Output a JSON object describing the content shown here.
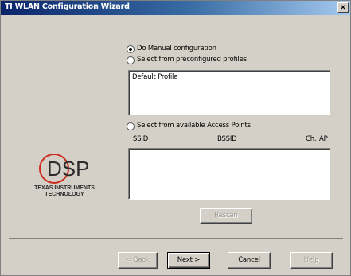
{
  "window": {
    "title": "TI WLAN Configuration Wizard",
    "close_symbol": "×"
  },
  "options": {
    "manual_label": "Do Manual configuration",
    "preconfigured_label": "Select from preconfigured profiles",
    "access_points_label": "Select from available Access Points",
    "selected": "manual"
  },
  "profiles": [
    "Default Profile"
  ],
  "ap_table": {
    "columns": [
      "SSID",
      "BSSID",
      "Ch.",
      "AP"
    ],
    "rows": []
  },
  "rescan_label": "Rescan",
  "logo": {
    "text": "DSP",
    "line1": "TEXAS INSTRUMENTS",
    "line2": "TECHNOLOGY",
    "accent": "#cc2b1d"
  },
  "buttons": {
    "back": "< Back",
    "next": "Next >",
    "cancel": "Cancel",
    "help": "Help"
  }
}
